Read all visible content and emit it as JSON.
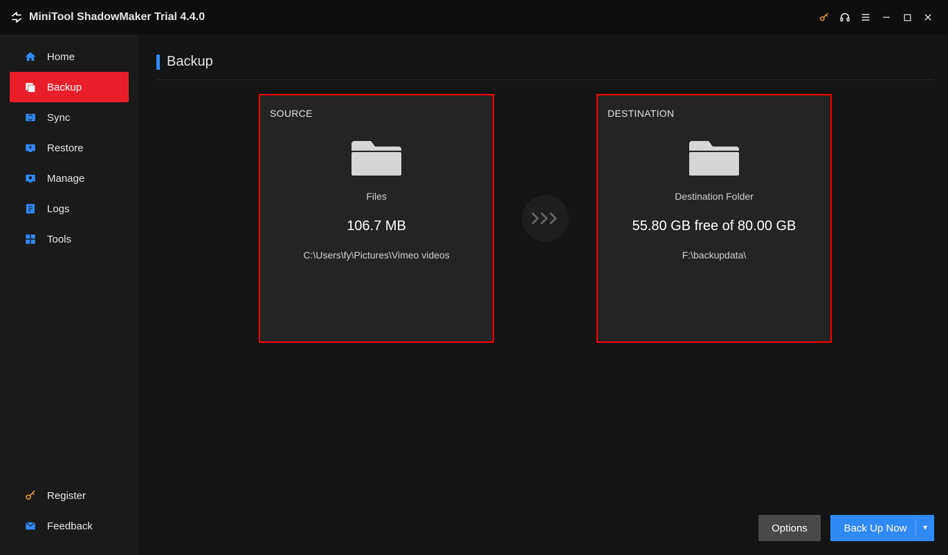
{
  "app": {
    "title": "MiniTool ShadowMaker Trial 4.4.0"
  },
  "sidebar": {
    "items": [
      {
        "label": "Home"
      },
      {
        "label": "Backup"
      },
      {
        "label": "Sync"
      },
      {
        "label": "Restore"
      },
      {
        "label": "Manage"
      },
      {
        "label": "Logs"
      },
      {
        "label": "Tools"
      }
    ],
    "bottom": {
      "register": "Register",
      "feedback": "Feedback"
    }
  },
  "page": {
    "title": "Backup"
  },
  "source": {
    "heading": "SOURCE",
    "type_label": "Files",
    "size": "106.7 MB",
    "path": "C:\\Users\\fy\\Pictures\\Vimeo videos"
  },
  "destination": {
    "heading": "DESTINATION",
    "type_label": "Destination Folder",
    "free_text": "55.80 GB free of 80.00 GB",
    "path": "F:\\backupdata\\"
  },
  "buttons": {
    "options": "Options",
    "backup_now": "Back Up Now"
  }
}
